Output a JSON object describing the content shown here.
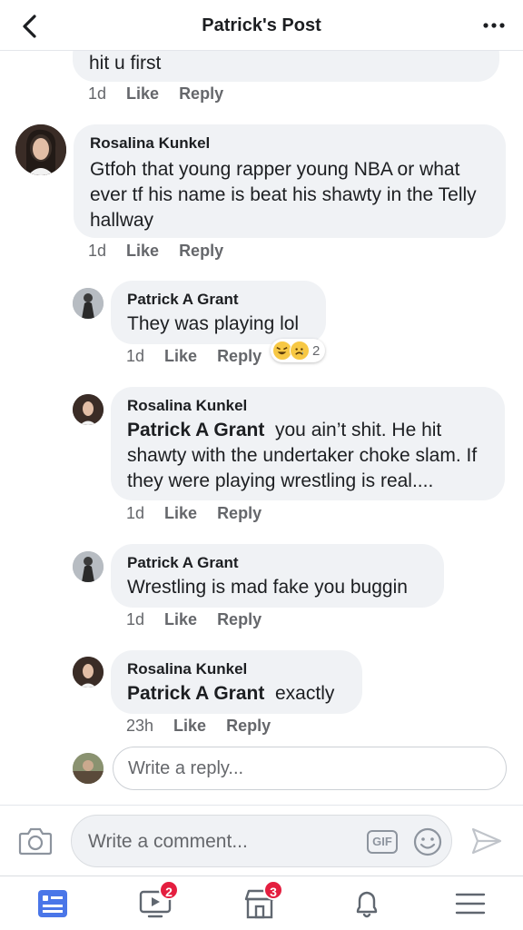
{
  "header": {
    "title": "Patrick's Post",
    "back_icon": "back-chevron-icon",
    "more_icon": "more-dots-icon"
  },
  "comments": [
    {
      "author": "",
      "text": "hit u first",
      "time": "1d",
      "like": "Like",
      "reply": "Reply"
    },
    {
      "author": "Rosalina Kunkel",
      "text": "Gtfoh that young rapper young NBA or what ever tf his name is beat his shawty in the Telly hallway",
      "time": "1d",
      "like": "Like",
      "reply": "Reply"
    },
    {
      "author": "Patrick A Grant",
      "text": "They was playing lol",
      "time": "1d",
      "like": "Like",
      "reply": "Reply",
      "reaction_count": "2",
      "reaction_icons": [
        "laughing-emoji-icon",
        "sad-emoji-icon"
      ]
    },
    {
      "author": "Rosalina Kunkel",
      "mention": "Patrick A Grant",
      "text": "you ain’t shit. He hit shawty with the undertaker choke slam. If they were playing wrestling is real....",
      "time": "1d",
      "like": "Like",
      "reply": "Reply"
    },
    {
      "author": "Patrick A Grant",
      "text": "Wrestling is mad fake you buggin",
      "time": "1d",
      "like": "Like",
      "reply": "Reply"
    },
    {
      "author": "Rosalina Kunkel",
      "mention": "Patrick A Grant",
      "text": "exactly",
      "time": "23h",
      "like": "Like",
      "reply": "Reply"
    }
  ],
  "reply_box": {
    "placeholder": "Write a reply..."
  },
  "composer": {
    "placeholder": "Write a comment...",
    "gif_label": "GIF"
  },
  "tabs": [
    {
      "name": "news-feed",
      "badge": ""
    },
    {
      "name": "watch",
      "badge": "2"
    },
    {
      "name": "marketplace",
      "badge": "3"
    },
    {
      "name": "notifications",
      "badge": ""
    },
    {
      "name": "menu",
      "badge": ""
    }
  ],
  "colors": {
    "accent": "#4a76e8",
    "bubble": "#f0f2f5",
    "meta": "#65676b",
    "badge": "#e41e3f"
  }
}
